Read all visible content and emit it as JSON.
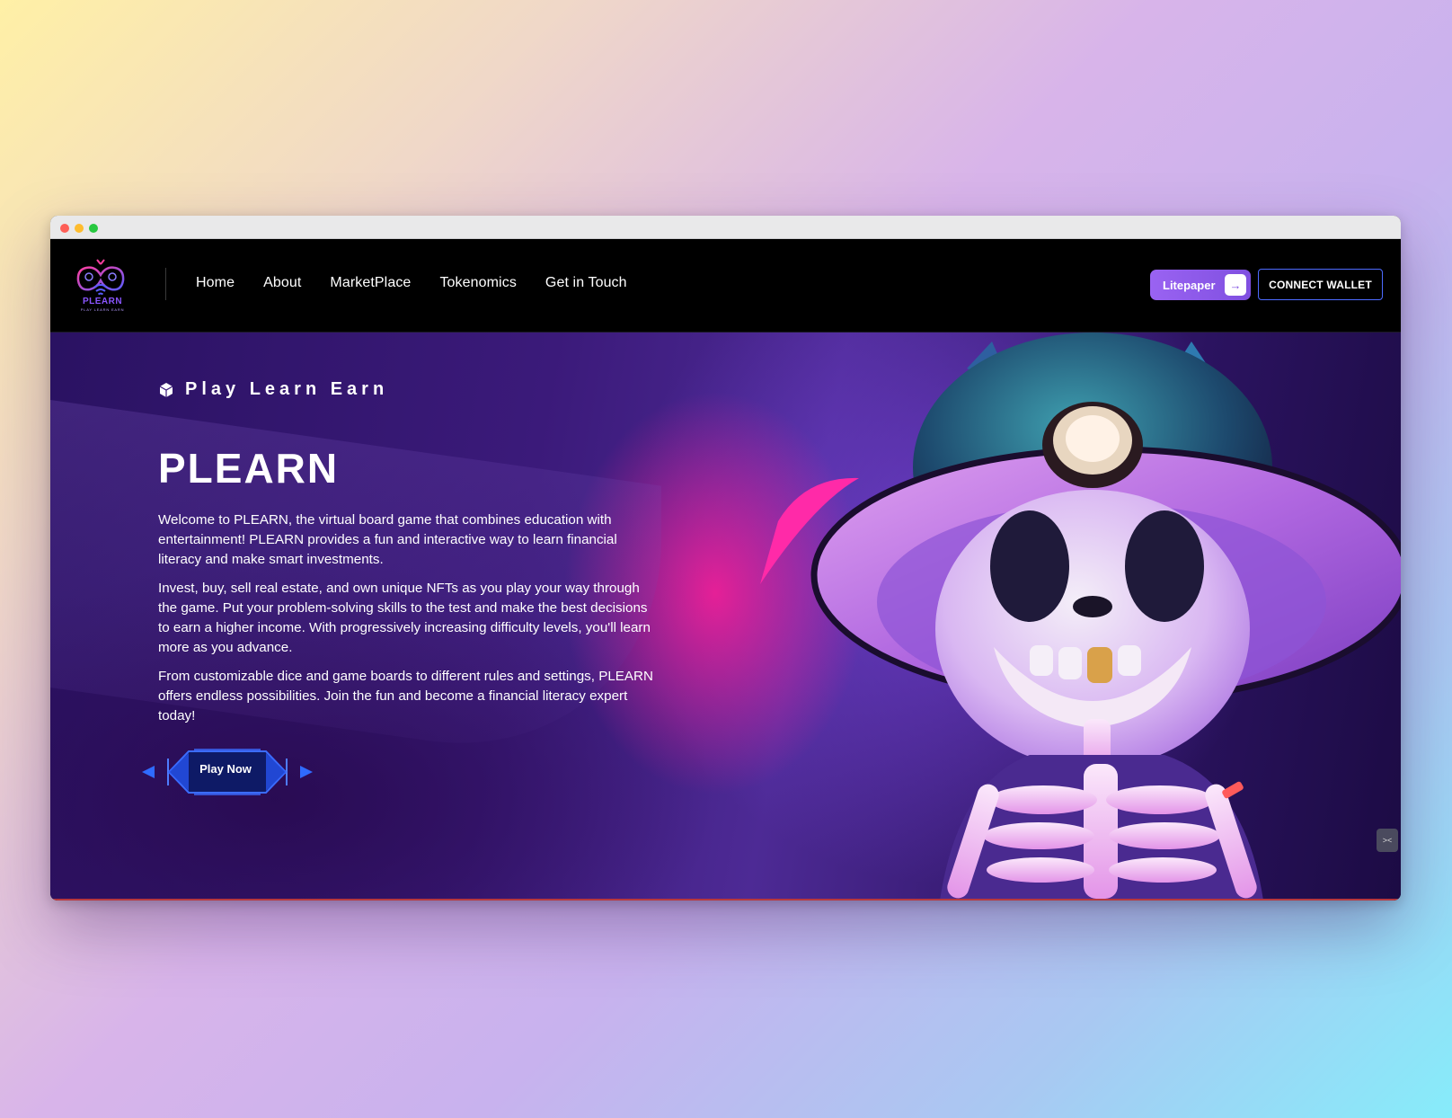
{
  "window": {
    "controls": [
      "close",
      "minimize",
      "maximize"
    ]
  },
  "navbar": {
    "logo": {
      "icon": "plearn-logo-icon",
      "text": "PLEARN",
      "subtext": "PLAY LEARN EARN"
    },
    "links": [
      "Home",
      "About",
      "MarketPlace",
      "Tokenomics",
      "Get in Touch"
    ],
    "litepaper_label": "Litepaper",
    "litepaper_icon": "arrow-right-icon",
    "connect_label": "CONNECT WALLET"
  },
  "hero": {
    "tagline": "Play Learn Earn",
    "tagline_icon": "cube-icon",
    "title": "PLEARN",
    "paragraphs": [
      "Welcome to PLEARN, the virtual board game that combines education with entertainment! PLEARN provides a fun and interactive way to learn financial literacy and make smart investments.",
      "Invest, buy, sell real estate, and own unique NFTs as you play your way through the game. Put your problem-solving skills to the test and make the best decisions to earn a higher income. With progressively increasing difficulty levels, you'll learn more as you advance.",
      "From customizable dice and game boards to different rules and settings, PLEARN offers endless possibilities. Join the fun and become a financial literacy expert today!"
    ],
    "play_label": "Play Now",
    "illustration": "skeleton-character-illustration"
  },
  "widgets": {
    "side_widget_icon": "code-toggle-icon",
    "chat_icon": "chat-bubble-icon"
  },
  "colors": {
    "accent_purple": "#9a63f2",
    "connect_border": "#4d6bff",
    "chat_green": "#0ea14c",
    "hero_pink": "#ff1e96"
  }
}
